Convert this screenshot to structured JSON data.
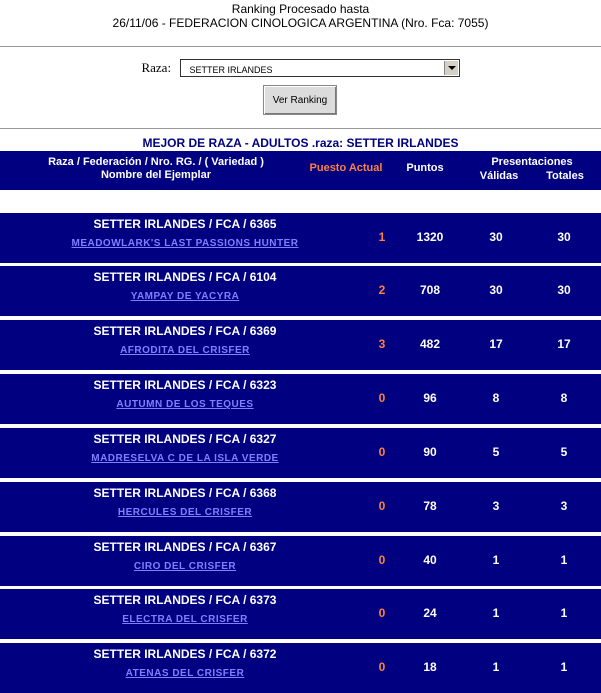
{
  "header": {
    "line1": "Ranking Procesado hasta",
    "line2": "26/11/06 - FEDERACION CINOLOGICA ARGENTINA (Nro. Fca: 7055)"
  },
  "form": {
    "raza_label": "Raza:",
    "raza_selected": "SETTER IRLANDES",
    "button_label": "Ver Ranking"
  },
  "table": {
    "title": "MEJOR DE RAZA - ADULTOS .raza: SETTER IRLANDES",
    "col_raza_line1": "Raza / Federación / Nro. RG. / ( Variedad )",
    "col_raza_line2": "Nombre del Ejemplar",
    "col_puesto": "Puesto Actual",
    "col_puntos": "Puntos",
    "col_presentaciones": "Presentaciones",
    "col_validas": "Válidas",
    "col_totales": "Totales",
    "rows": [
      {
        "raza": "SETTER IRLANDES / FCA / 6365",
        "nombre": "MEADOWLARK'S LAST PASSIONS HUNTER",
        "puesto": "1",
        "puntos": "1320",
        "validas": "30",
        "totales": "30"
      },
      {
        "raza": "SETTER IRLANDES / FCA / 6104",
        "nombre": "YAMPAY DE YACYRA",
        "puesto": "2",
        "puntos": "708",
        "validas": "30",
        "totales": "30"
      },
      {
        "raza": "SETTER IRLANDES / FCA / 6369",
        "nombre": "AFRODITA DEL CRISFER",
        "puesto": "3",
        "puntos": "482",
        "validas": "17",
        "totales": "17"
      },
      {
        "raza": "SETTER IRLANDES / FCA / 6323",
        "nombre": "AUTUMN DE LOS TEQUES",
        "puesto": "0",
        "puntos": "96",
        "validas": "8",
        "totales": "8"
      },
      {
        "raza": "SETTER IRLANDES / FCA / 6327",
        "nombre": "MADRESELVA C DE LA ISLA VERDE",
        "puesto": "0",
        "puntos": "90",
        "validas": "5",
        "totales": "5"
      },
      {
        "raza": "SETTER IRLANDES / FCA / 6368",
        "nombre": "HERCULES DEL CRISFER",
        "puesto": "0",
        "puntos": "78",
        "validas": "3",
        "totales": "3"
      },
      {
        "raza": "SETTER IRLANDES / FCA / 6367",
        "nombre": "CIRO DEL CRISFER",
        "puesto": "0",
        "puntos": "40",
        "validas": "1",
        "totales": "1"
      },
      {
        "raza": "SETTER IRLANDES / FCA / 6373",
        "nombre": "ELECTRA DEL CRISFER",
        "puesto": "0",
        "puntos": "24",
        "validas": "1",
        "totales": "1"
      },
      {
        "raza": "SETTER IRLANDES / FCA / 6372",
        "nombre": "ATENAS DEL CRISFER",
        "puesto": "0",
        "puntos": "18",
        "validas": "1",
        "totales": "1"
      }
    ]
  }
}
